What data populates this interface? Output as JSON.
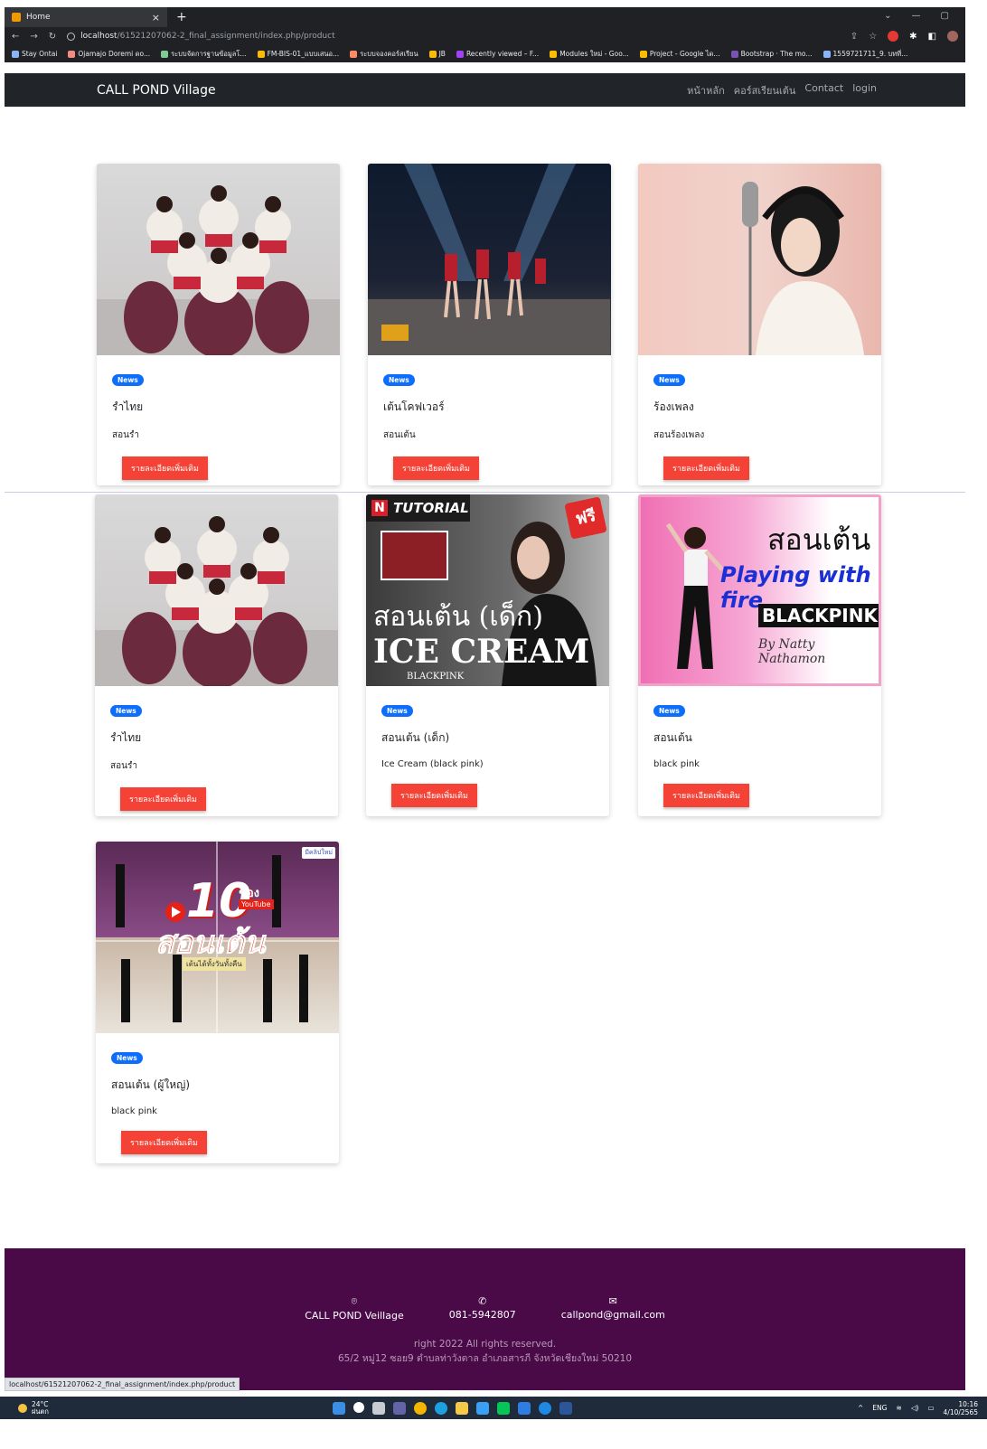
{
  "browser": {
    "tab_title": "Home",
    "tab_close": "×",
    "new_tab": "+",
    "url_host": "localhost",
    "url_path": "/61521207062-2_final_assignment/index.php/product",
    "bookmarks": [
      "Stay Ontai",
      "Ojamajo Doremi ดo...",
      "ระบบจัดการฐานข้อมูลโ...",
      "FM-BIS-01_แบบเสนอ...",
      "ระบบจองคอร์สเรียน",
      "JB",
      "Recently viewed – F...",
      "Modules ใหม่ - Goo...",
      "Project - Google ได...",
      "Bootstrap · The mo...",
      "1559721711_9. บทที่..."
    ],
    "status_url": "localhost/61521207062-2_final_assignment/index.php/product"
  },
  "navbar": {
    "brand": "CALL POND Village",
    "links": [
      "หน้าหลัก",
      "คอร์สเรียนเต้น",
      "Contact",
      "login"
    ]
  },
  "cards": [
    {
      "badge": "News",
      "title": "รำไทย",
      "subtitle": "สอนรำ",
      "button": "รายละเอียดเพิ่มเติม"
    },
    {
      "badge": "News",
      "title": "เต้นโคฟเวอร์",
      "subtitle": "สอนเต้น",
      "button": "รายละเอียดเพิ่มเติม"
    },
    {
      "badge": "News",
      "title": "ร้องเพลง",
      "subtitle": "สอนร้องเพลง",
      "button": "รายละเอียดเพิ่มเติม"
    },
    {
      "badge": "News",
      "title": "รำไทย",
      "subtitle": "สอนรำ",
      "button": "รายละเอียดเพิ่มเติม"
    },
    {
      "badge": "News",
      "title": "สอนเต้น (เด็ก)",
      "subtitle": "Ice Cream (black pink)",
      "button": "รายละเอียดเพิ่มเติม",
      "image_text": {
        "brand": "TUTORIAL",
        "free": "ฟรี",
        "line1": "สอนเต้น (เด็ก)",
        "line2": "ICE CREAM",
        "line3": "BLACKPINK"
      }
    },
    {
      "badge": "News",
      "title": "สอนเต้น",
      "subtitle": "black pink",
      "button": "รายละเอียดเพิ่มเติม",
      "image_text": {
        "line1": "สอนเต้น",
        "line2": "Playing with fire",
        "line3": "BLACKPINK",
        "line4": "By Natty Nathamon"
      }
    },
    {
      "badge": "News",
      "title": "สอนเต้น (ผู้ใหญ่)",
      "subtitle": "black pink",
      "button": "รายละเอียดเพิ่มเติม",
      "image_text": {
        "num": "10",
        "ch": "ช่อง",
        "yt": "YouTube",
        "main": "สอนเต้น",
        "sub": "เต้นได้ทั้งวันทั้งคืน",
        "tag": "มีคลิปใหม่"
      }
    }
  ],
  "footer": {
    "address_label": "CALL POND Veillage",
    "phone": "081-5942807",
    "email": "callpond@gmail.com",
    "rights": "right 2022 All rights reserved.",
    "address": "65/2 หมู่12 ซอย9 ตำบลท่าวังตาล อำเภอสารภี จังหวัดเชียงใหม่ 50210"
  },
  "taskbar": {
    "temp": "24°C",
    "weather": "ฝนตก",
    "lang": "ENG",
    "time": "10:16",
    "date": "4/10/2565"
  },
  "colors": {
    "navbar": "#212529",
    "badge": "#0d6efd",
    "button": "#f44336",
    "footer": "#4a0a48"
  }
}
